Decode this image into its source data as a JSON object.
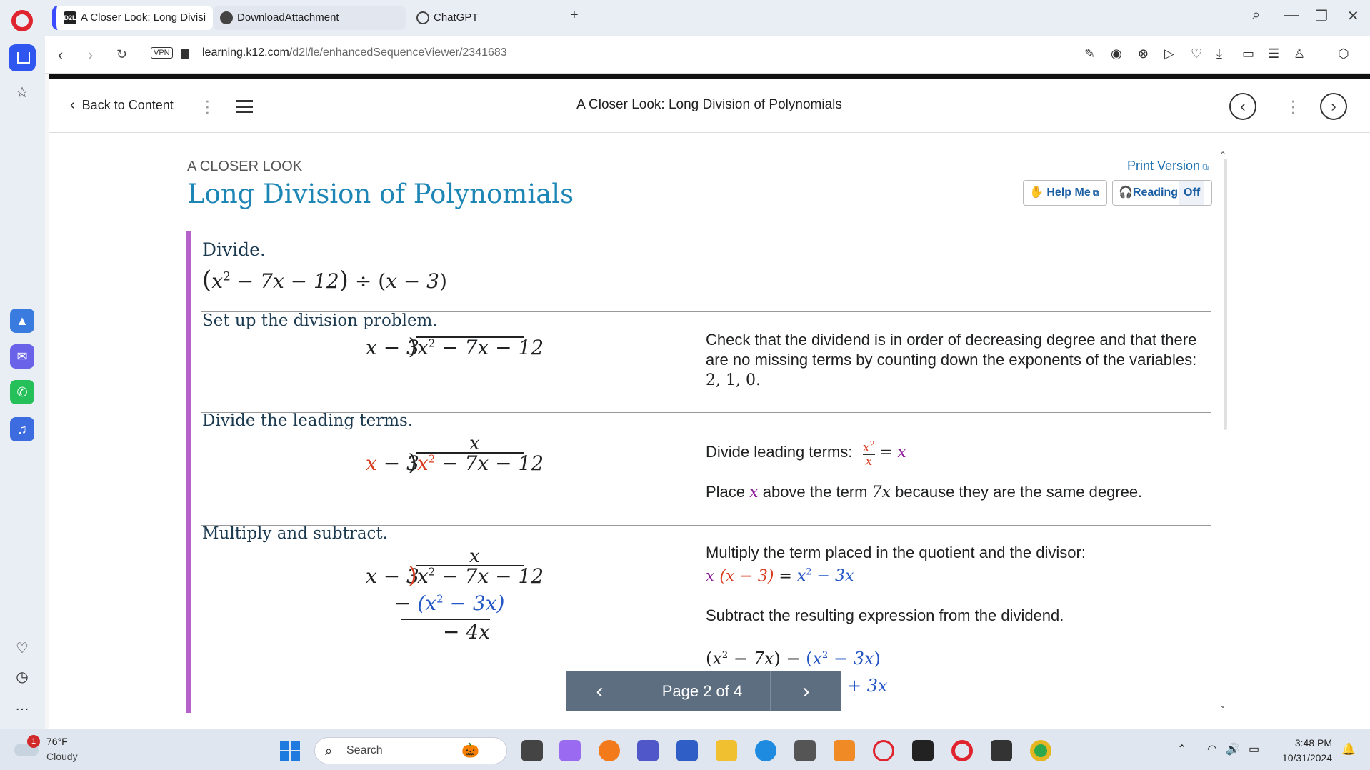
{
  "browser": {
    "tabs": [
      {
        "label": "A Closer Look: Long Divisi",
        "favicon": "D2L"
      },
      {
        "label": "DownloadAttachment"
      },
      {
        "label": "ChatGPT"
      }
    ],
    "new_tab": "+",
    "url_host": "learning.k12.com",
    "url_path": "/d2l/le/enhancedSequenceViewer/2341683",
    "vpn_label": "VPN"
  },
  "nav": {
    "back_label": "Back to Content",
    "topic_title": "A Closer Look: Long Division of Polynomials"
  },
  "header": {
    "kicker": "A CLOSER LOOK",
    "title": "Long Division of Polynomials",
    "print_version": "Print Version",
    "help_label": "Help Me",
    "reading_label": "Reading",
    "reading_state": "Off"
  },
  "steps": {
    "intro_head": "Divide.",
    "setup_head": "Set up the division problem.",
    "setup_desc": "Check that the dividend is in order of decreasing degree and that there are no missing terms by counting down the exponents of the variables:",
    "setup_exponents": "2, 1, 0.",
    "leading_head": "Divide the leading terms.",
    "leading_desc_label": "Divide leading terms:",
    "leading_place_pre": "Place",
    "leading_place_mid": "above the term",
    "leading_place_post": "because they are the same degree.",
    "multiply_head": "Multiply and subtract.",
    "multiply_desc": "Multiply the term placed in the quotient and the divisor:",
    "subtract_desc": "Subtract the resulting expression from the dividend."
  },
  "pager": {
    "label": "Page 2 of 4"
  },
  "taskbar": {
    "weather_badge": "1",
    "temperature": "76°F",
    "condition": "Cloudy",
    "search_placeholder": "Search",
    "time": "3:48 PM",
    "date": "10/31/2024"
  },
  "colors": {
    "title_blue": "#1e86b5",
    "accent_purple": "#b561c9",
    "quotient_purple": "#8d1e9b",
    "term_red": "#d83b1e",
    "term_blue": "#2457c5",
    "pager_bg": "#5c6e80"
  }
}
